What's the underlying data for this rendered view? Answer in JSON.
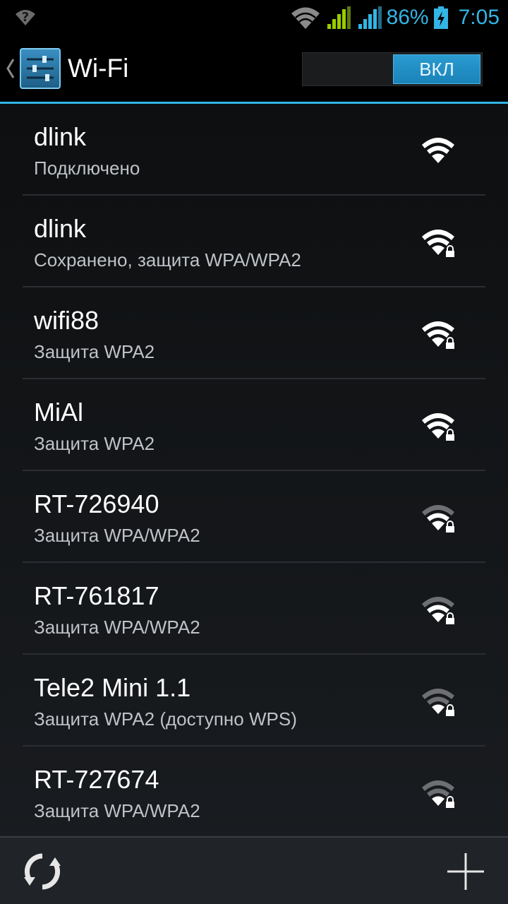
{
  "status_bar": {
    "left_icon": "wifi-question-icon",
    "battery_percent": "86%",
    "time": "7:05",
    "accent": "#33b5e5"
  },
  "action_bar": {
    "title": "Wi-Fi",
    "switch_label": "ВКЛ",
    "icon": "settings-sliders-icon"
  },
  "networks": [
    {
      "ssid": "dlink",
      "summary": "Подключено",
      "secured": false,
      "strength": "strong"
    },
    {
      "ssid": "dlink",
      "summary": "Сохранено, защита WPA/WPA2",
      "secured": true,
      "strength": "strong"
    },
    {
      "ssid": "wifi88",
      "summary": "Защита WPA2",
      "secured": true,
      "strength": "strong"
    },
    {
      "ssid": "MiAl",
      "summary": "Защита WPA2",
      "secured": true,
      "strength": "strong"
    },
    {
      "ssid": "RT-726940",
      "summary": "Защита WPA/WPA2",
      "secured": true,
      "strength": "medium"
    },
    {
      "ssid": "RT-761817",
      "summary": "Защита WPA/WPA2",
      "secured": true,
      "strength": "medium"
    },
    {
      "ssid": "Tele2 Mini 1.1",
      "summary": "Защита WPA2 (доступно WPS)",
      "secured": true,
      "strength": "weak"
    },
    {
      "ssid": "RT-727674",
      "summary": "Защита WPA/WPA2",
      "secured": true,
      "strength": "weak"
    }
  ],
  "bottom_bar": {
    "scan_icon": "refresh-icon",
    "add_icon": "plus-icon"
  }
}
